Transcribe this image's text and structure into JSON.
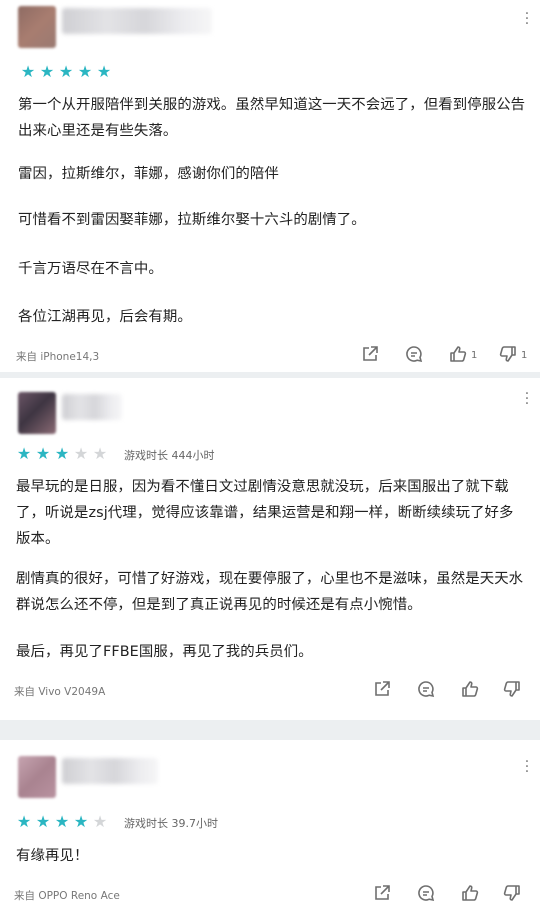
{
  "colors": {
    "star_on": "#2bb6c2",
    "star_off": "#d4d6d8",
    "card_bg": "#ffffff",
    "page_bg": "#eceff1"
  },
  "icons": {
    "share": "share-icon",
    "comment": "comment-icon",
    "like": "thumbs-up-icon",
    "dislike": "thumbs-down-icon",
    "more": "more-vertical-icon"
  },
  "reviews": [
    {
      "rating": 5,
      "playtime": "",
      "paragraphs": [
        "第一个从开服陪伴到关服的游戏。虽然早知道这一天不会远了，但看到停服公告出来心里还是有些失落。",
        "雷因，拉斯维尔，菲娜，感谢你们的陪伴",
        "可惜看不到雷因娶菲娜，拉斯维尔娶十六斗的剧情了。",
        "千言万语尽在不言中。",
        "各位江湖再见，后会有期。"
      ],
      "device": "来自 iPhone14,3",
      "likes": "1",
      "dislikes": "1"
    },
    {
      "rating": 3,
      "playtime": "游戏时长 444小时",
      "paragraphs": [
        "最早玩的是日服，因为看不懂日文过剧情没意思就没玩，后来国服出了就下载了，听说是zsj代理，觉得应该靠谱，结果运营是和翔一样，断断续续玩了好多版本。",
        "剧情真的很好，可惜了好游戏，现在要停服了，心里也不是滋味，虽然是天天水群说怎么还不停，但是到了真正说再见的时候还是有点小惋惜。",
        "最后，再见了FFBE国服，再见了我的兵员们。"
      ],
      "device": "来自 Vivo V2049A",
      "likes": "",
      "dislikes": ""
    },
    {
      "rating": 4,
      "playtime": "游戏时长 39.7小时",
      "paragraphs": [
        "有缘再见！"
      ],
      "device": "来自 OPPO Reno Ace",
      "likes": "",
      "dislikes": ""
    }
  ]
}
